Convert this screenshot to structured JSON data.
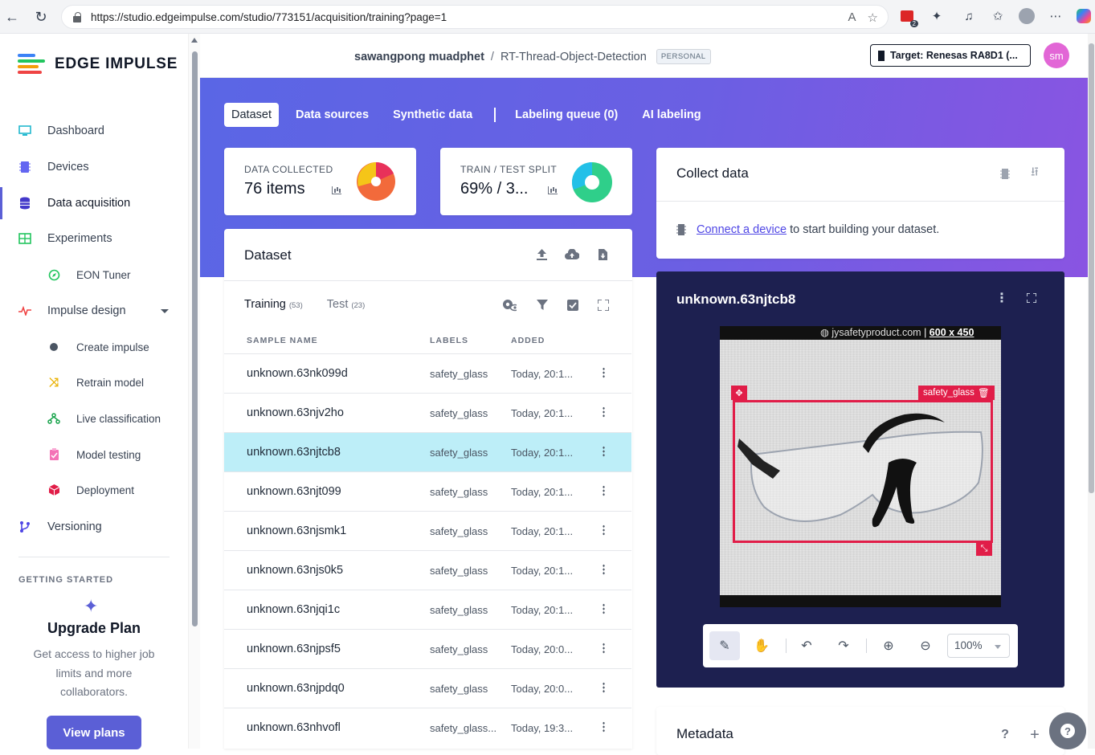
{
  "browser": {
    "url": "https://studio.edgeimpulse.com/studio/773151/acquisition/training?page=1",
    "notification_count": "2"
  },
  "brand": {
    "name": "EDGE IMPULSE"
  },
  "sidebar": {
    "items": [
      {
        "label": "Dashboard",
        "icon": "monitor-icon"
      },
      {
        "label": "Devices",
        "icon": "chip-icon"
      },
      {
        "label": "Data acquisition",
        "icon": "database-icon"
      },
      {
        "label": "Experiments",
        "icon": "grid-icon"
      },
      {
        "label": "EON Tuner",
        "icon": "compass-icon"
      },
      {
        "label": "Impulse design",
        "icon": "pulse-icon"
      },
      {
        "label": "Create impulse",
        "icon": "dot-icon"
      },
      {
        "label": "Retrain model",
        "icon": "shuffle-icon"
      },
      {
        "label": "Live classification",
        "icon": "branch-icon"
      },
      {
        "label": "Model testing",
        "icon": "clipboard-icon"
      },
      {
        "label": "Deployment",
        "icon": "cube-icon"
      },
      {
        "label": "Versioning",
        "icon": "git-branch-icon"
      }
    ],
    "getting_started": "GETTING STARTED",
    "upgrade": {
      "title": "Upgrade Plan",
      "desc": "Get access to higher job limits and more collaborators.",
      "button": "View plans"
    }
  },
  "header": {
    "owner": "sawangpong muadphet",
    "separator": "/",
    "project": "RT-Thread-Object-Detection",
    "badge": "PERSONAL",
    "target": "Target: Renesas RA8D1 (...",
    "avatar": "sm"
  },
  "tabs": [
    "Dataset",
    "Data sources",
    "Synthetic data",
    "Labeling queue (0)",
    "AI labeling"
  ],
  "stats": {
    "collected_label": "DATA COLLECTED",
    "collected_value": "76 items",
    "split_label": "TRAIN / TEST SPLIT",
    "split_value": "69% / 3...",
    "split_fraction_train": 0.69
  },
  "dataset": {
    "title": "Dataset",
    "training_label": "Training",
    "training_count": "(53)",
    "test_label": "Test",
    "test_count": "(23)",
    "columns": [
      "SAMPLE NAME",
      "LABELS",
      "ADDED"
    ],
    "rows": [
      {
        "name": "unknown.63nk099d",
        "label": "safety_glass",
        "added": "Today, 20:1..."
      },
      {
        "name": "unknown.63njv2ho",
        "label": "safety_glass",
        "added": "Today, 20:1..."
      },
      {
        "name": "unknown.63njtcb8",
        "label": "safety_glass",
        "added": "Today, 20:1..."
      },
      {
        "name": "unknown.63njt099",
        "label": "safety_glass",
        "added": "Today, 20:1..."
      },
      {
        "name": "unknown.63njsmk1",
        "label": "safety_glass",
        "added": "Today, 20:1..."
      },
      {
        "name": "unknown.63njs0k5",
        "label": "safety_glass",
        "added": "Today, 20:1..."
      },
      {
        "name": "unknown.63njqi1c",
        "label": "safety_glass",
        "added": "Today, 20:1..."
      },
      {
        "name": "unknown.63njpsf5",
        "label": "safety_glass",
        "added": "Today, 20:0..."
      },
      {
        "name": "unknown.63njpdq0",
        "label": "safety_glass",
        "added": "Today, 20:0..."
      },
      {
        "name": "unknown.63nhvofl",
        "label": "safety_glass...",
        "added": "Today, 19:3..."
      }
    ]
  },
  "collect": {
    "title": "Collect data",
    "link": "Connect a device",
    "text": " to start building your dataset."
  },
  "preview": {
    "title": "unknown.63njtcb8",
    "watermark_site": "jysafetyproduct.com",
    "watermark_size": "600 x 450",
    "bbox_label": "safety_glass",
    "zoom": "100%"
  },
  "metadata": {
    "title": "Metadata"
  },
  "colors": {
    "accent": "#5b5fd6",
    "bbox": "#e11d48",
    "selected_row": "#bdeef8"
  }
}
